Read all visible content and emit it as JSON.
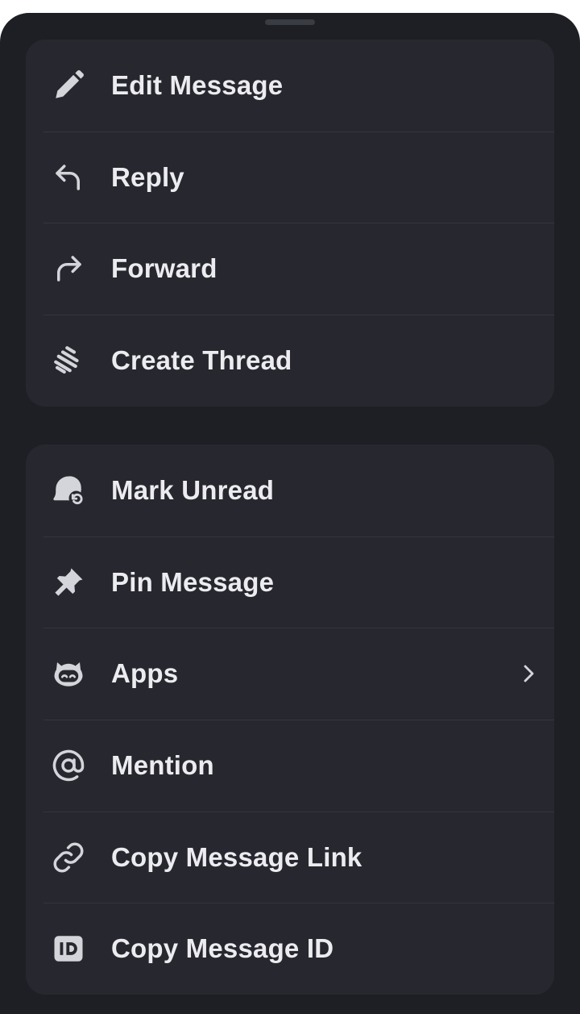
{
  "sheet": {
    "handle": "drag-handle"
  },
  "group_primary": {
    "items": [
      {
        "label": "Edit Message",
        "icon": "pencil-icon"
      },
      {
        "label": "Reply",
        "icon": "reply-arrow-icon"
      },
      {
        "label": "Forward",
        "icon": "forward-arrow-icon"
      },
      {
        "label": "Create Thread",
        "icon": "thread-icon"
      }
    ]
  },
  "group_secondary": {
    "items": [
      {
        "label": "Mark Unread",
        "icon": "mark-unread-icon"
      },
      {
        "label": "Pin Message",
        "icon": "pin-icon"
      },
      {
        "label": "Apps",
        "icon": "robot-icon",
        "has_submenu": true
      },
      {
        "label": "Mention",
        "icon": "at-sign-icon"
      },
      {
        "label": "Copy Message Link",
        "icon": "link-icon"
      },
      {
        "label": "Copy Message ID",
        "icon": "id-icon"
      }
    ]
  },
  "colors": {
    "background": "#1e1f24",
    "card": "#27282f",
    "text": "#ececf0",
    "icon": "#d4d5da",
    "divider": "#33353d"
  }
}
